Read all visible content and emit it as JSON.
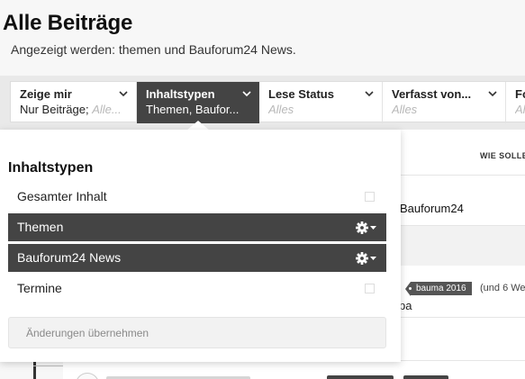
{
  "page": {
    "title": "Alle Beiträge",
    "subtitle": "Angezeigt werden: themen und Bauforum24 News."
  },
  "filters": [
    {
      "label": "Zeige mir",
      "value": "Nur Beiträge; ",
      "placeholder": "Alle..."
    },
    {
      "label": "Inhaltstypen",
      "value": "Themen, Baufor...",
      "placeholder": ""
    },
    {
      "label": "Lese Status",
      "value": "",
      "placeholder": "Alles"
    },
    {
      "label": "Verfasst von...",
      "value": "",
      "placeholder": "Alles"
    },
    {
      "label": "Fo",
      "value": "",
      "placeholder": "Alle"
    }
  ],
  "dropdown": {
    "title": "Inhaltstypen",
    "items": [
      {
        "label": "Gesamter Inhalt",
        "selected": false
      },
      {
        "label": "Themen",
        "selected": true
      },
      {
        "label": "Bauforum24 News",
        "selected": true
      },
      {
        "label": "Termine",
        "selected": false
      }
    ],
    "apply_label": "Änderungen übernehmen"
  },
  "background": {
    "sort_label": "WIE SOLLE",
    "forum_name": "Bauforum24",
    "tag": "bauma 2016",
    "weeks_text": "(und 6 We",
    "snippet": "pa"
  },
  "colors": {
    "active_filter": "#444444",
    "selected_row": "#444444",
    "panel_bg": "#ffffff"
  }
}
